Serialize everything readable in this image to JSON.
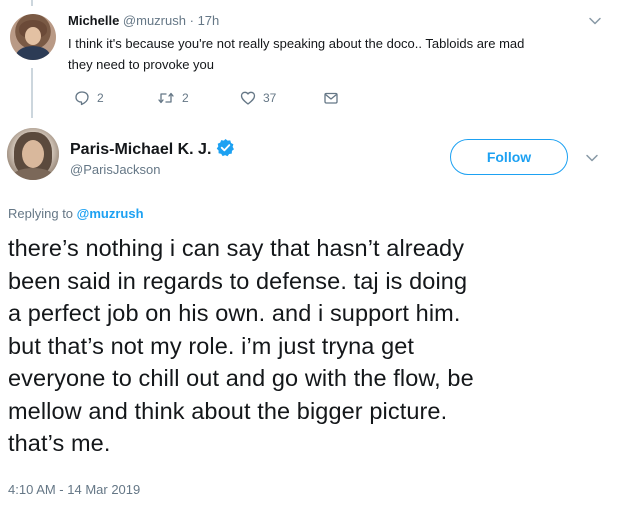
{
  "reply_tweet": {
    "name": "Michelle",
    "handle": "@muzrush",
    "separator": "·",
    "time": "17h",
    "text_line1": "I think it's because you're not really speaking about the doco.. Tabloids are mad",
    "text_line2": "they need to provoke you",
    "actions": {
      "reply_count": "2",
      "retweet_count": "2",
      "like_count": "37"
    }
  },
  "main_tweet": {
    "name": "Paris-Michael K. J.",
    "handle": "@ParisJackson",
    "follow_label": "Follow",
    "replying_prefix": "Replying to",
    "replying_handle": "@muzrush",
    "text_lines": [
      "there’s nothing i can say that hasn’t already",
      "been said in regards to defense. taj is doing",
      "a perfect job on his own. and i support him.",
      "but that’s not my role. i’m just tryna get",
      "everyone to chill out and go with the flow, be",
      "mellow and think about the bigger picture.",
      "that’s me."
    ],
    "timestamp": "4:10 AM - 14 Mar 2019"
  },
  "colors": {
    "accent": "#1da1f2",
    "text": "#14171a",
    "muted": "#657786"
  }
}
